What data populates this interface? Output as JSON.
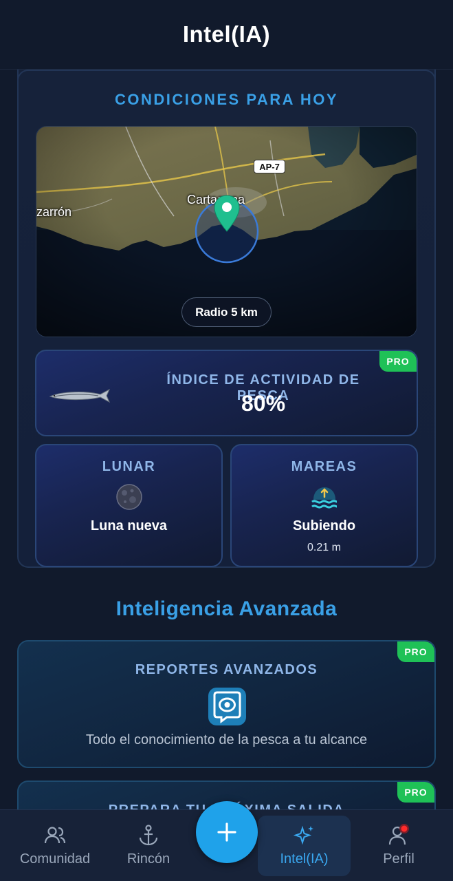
{
  "header": {
    "title": "Intel(IA)"
  },
  "conditions": {
    "title": "CONDICIONES PARA HOY",
    "map": {
      "city_label": "Cartagena",
      "town_label": "zarrón",
      "road_badge": "AP-7",
      "radius_chip": "Radio 5 km"
    },
    "activity_index": {
      "label": "ÍNDICE DE ACTIVIDAD DE PESCA",
      "value": "80%",
      "badge": "PRO"
    },
    "lunar": {
      "label": "LUNAR",
      "value": "Luna nueva",
      "icon": "moon-icon"
    },
    "tides": {
      "label": "MAREAS",
      "value": "Subiendo",
      "height": "0.21 m",
      "icon": "tide-icon"
    }
  },
  "advanced": {
    "title": "Inteligencia Avanzada",
    "reports": {
      "label": "REPORTES AVANZADOS",
      "description": "Todo el conocimiento de la pesca a tu alcance",
      "badge": "PRO",
      "icon": "eye-chat-icon"
    },
    "prepare": {
      "label": "PREPARA TU PRÓXIMA SALIDA",
      "badge": "PRO"
    }
  },
  "navbar": {
    "items": [
      {
        "label": "Comunidad",
        "icon": "community-icon"
      },
      {
        "label": "Rincón",
        "icon": "anchor-icon"
      },
      {
        "label": "Intel(IA)",
        "icon": "sparkle-icon"
      },
      {
        "label": "Perfil",
        "icon": "profile-icon"
      }
    ],
    "fab_icon": "plus-icon"
  },
  "colors": {
    "accent": "#3aa0e6",
    "pro_badge": "#1fc157",
    "background": "#111a2c",
    "fab": "#1fa2ea",
    "marker": "#1fbf8f"
  }
}
